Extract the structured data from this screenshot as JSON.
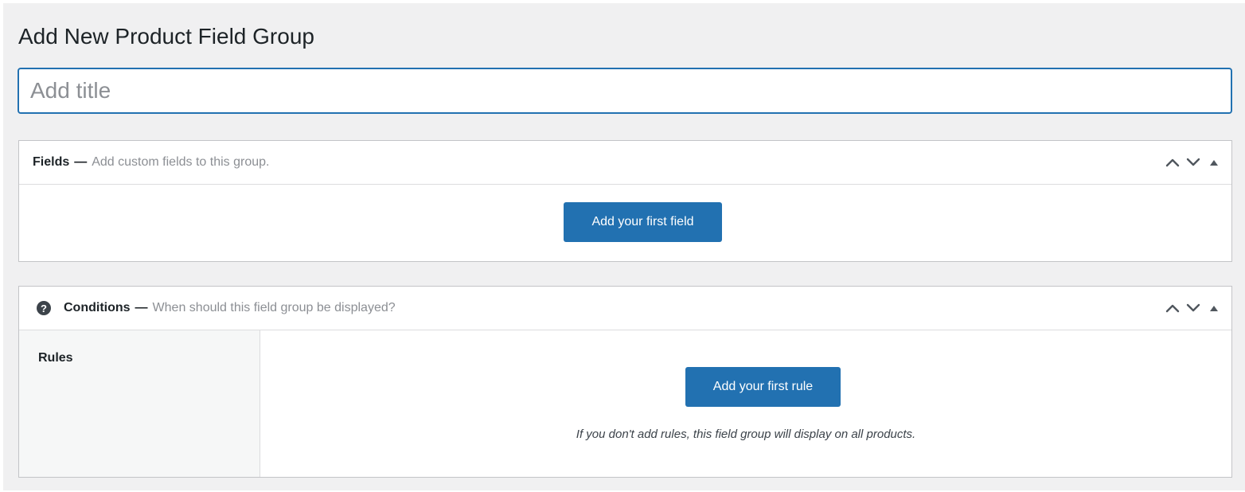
{
  "page": {
    "title": "Add New Product Field Group"
  },
  "title_input": {
    "placeholder": "Add title",
    "value": ""
  },
  "fields_box": {
    "title": "Fields",
    "separator": "—",
    "description": "Add custom fields to this group.",
    "add_button_label": "Add your first field",
    "actions": {
      "move_up_icon": "chevron-up-icon",
      "move_down_icon": "chevron-down-icon",
      "toggle_icon": "triangle-up-icon"
    }
  },
  "conditions_box": {
    "help_icon": "question-circle-icon",
    "help_glyph": "?",
    "title": "Conditions",
    "separator": "—",
    "description": "When should this field group be displayed?",
    "rules_label": "Rules",
    "add_rule_button_label": "Add your first rule",
    "note": "If you don't add rules, this field group will display on all products.",
    "actions": {
      "move_up_icon": "chevron-up-icon",
      "move_down_icon": "chevron-down-icon",
      "toggle_icon": "triangle-up-icon"
    }
  },
  "colors": {
    "accent": "#2271b1",
    "page_background": "#f0f0f1",
    "border": "#c3c4c7",
    "muted_text": "#8c8f94"
  }
}
